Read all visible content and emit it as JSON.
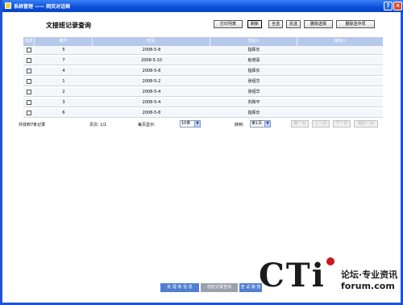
{
  "window": {
    "title": "系统管理 —— 网页对话框",
    "help_label": "?",
    "close_label": "×"
  },
  "page": {
    "title": "文接班记录查询"
  },
  "toolbar": {
    "buttons": [
      {
        "label": "打印列表"
      },
      {
        "label": "刷新"
      },
      {
        "label": "全选"
      },
      {
        "label": "反选"
      },
      {
        "label": "删除选择"
      },
      {
        "label": "删除选中项"
      }
    ]
  },
  "table": {
    "headers": [
      "选择",
      "编号",
      "时间",
      "交班人",
      "接班人"
    ],
    "rows": [
      {
        "id": "5",
        "time": "2008-5-8",
        "handover": "指挥长",
        "receiver": ""
      },
      {
        "id": "7",
        "time": "2008-5-10",
        "handover": "赵增喜",
        "receiver": ""
      },
      {
        "id": "4",
        "time": "2008-5-8",
        "handover": "指挥长",
        "receiver": ""
      },
      {
        "id": "1",
        "time": "2008-5-2",
        "handover": "张绍华",
        "receiver": ""
      },
      {
        "id": "2",
        "time": "2008-5-4",
        "handover": "张绍华",
        "receiver": ""
      },
      {
        "id": "3",
        "time": "2008-5-4",
        "handover": "刘和平",
        "receiver": ""
      },
      {
        "id": "6",
        "time": "2008-5-8",
        "handover": "指挥长",
        "receiver": ""
      }
    ]
  },
  "pagination": {
    "total_text": "共找到7条记录",
    "page_text": "页次: 1/1",
    "per_page_label": "每页显示:",
    "per_page_value": "10条",
    "goto_label": "转到:",
    "goto_value": "第1页",
    "first": "第一页",
    "prev": "上一页",
    "next": "下一页",
    "last": "最后一页"
  },
  "taskbar": {
    "items": [
      {
        "label": "处 理 条 信 息"
      },
      {
        "label": "值班记录查询"
      },
      {
        "label": "查 试 播 放"
      }
    ]
  },
  "watermark": {
    "logo": "CTi",
    "tagline": "论坛·专业资讯",
    "site": "forum.com"
  }
}
